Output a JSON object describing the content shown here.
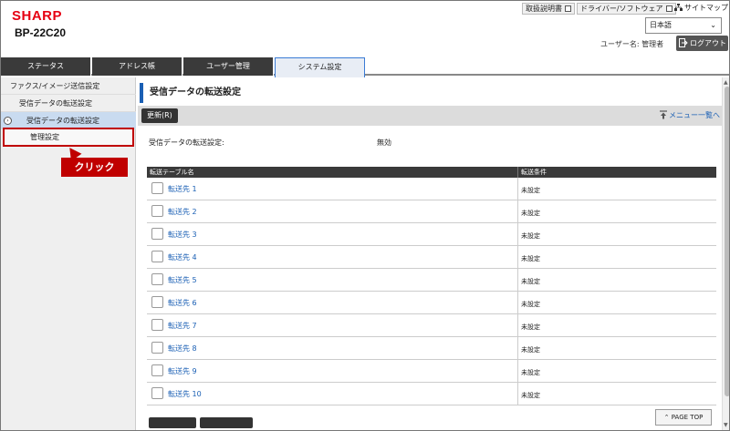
{
  "header": {
    "brand": "SHARP",
    "model": "BP-22C20",
    "links": {
      "manual": "取扱説明書",
      "driver": "ドライバー/ソフトウェア",
      "sitemap": "サイトマップ"
    },
    "language": "日本語",
    "user_label": "ユーザー名: 管理者",
    "logout": "ログアウト"
  },
  "tabs": [
    {
      "label": "ステータス"
    },
    {
      "label": "アドレス帳"
    },
    {
      "label": "ユーザー管理"
    },
    {
      "label": "システム設定"
    }
  ],
  "sidebar": {
    "items": [
      {
        "label": "ファクス/イメージ送信設定"
      },
      {
        "label": "受信データの転送設定"
      },
      {
        "label": "受信データの転送設定"
      },
      {
        "label": "管理設定"
      }
    ],
    "callout": "クリック"
  },
  "main": {
    "title": "受信データの転送設定",
    "update_button": "更新(R)",
    "menu_link": "メニュー一覧へ",
    "setting_label": "受信データの転送設定:",
    "setting_value": "無効",
    "table": {
      "headers": [
        "転送テーブル名",
        "転送条件"
      ],
      "rows": [
        {
          "name": "転送先 1",
          "cond": "未設定"
        },
        {
          "name": "転送先 2",
          "cond": "未設定"
        },
        {
          "name": "転送先 3",
          "cond": "未設定"
        },
        {
          "name": "転送先 4",
          "cond": "未設定"
        },
        {
          "name": "転送先 5",
          "cond": "未設定"
        },
        {
          "name": "転送先 6",
          "cond": "未設定"
        },
        {
          "name": "転送先 7",
          "cond": "未設定"
        },
        {
          "name": "転送先 8",
          "cond": "未設定"
        },
        {
          "name": "転送先 9",
          "cond": "未設定"
        },
        {
          "name": "転送先 10",
          "cond": "未設定"
        }
      ]
    },
    "page_top": "PAGE TOP"
  },
  "colors": {
    "brand": "#e60012",
    "accent": "#1a5fb4",
    "callout": "#c00000",
    "dark": "#3a3a3a"
  }
}
